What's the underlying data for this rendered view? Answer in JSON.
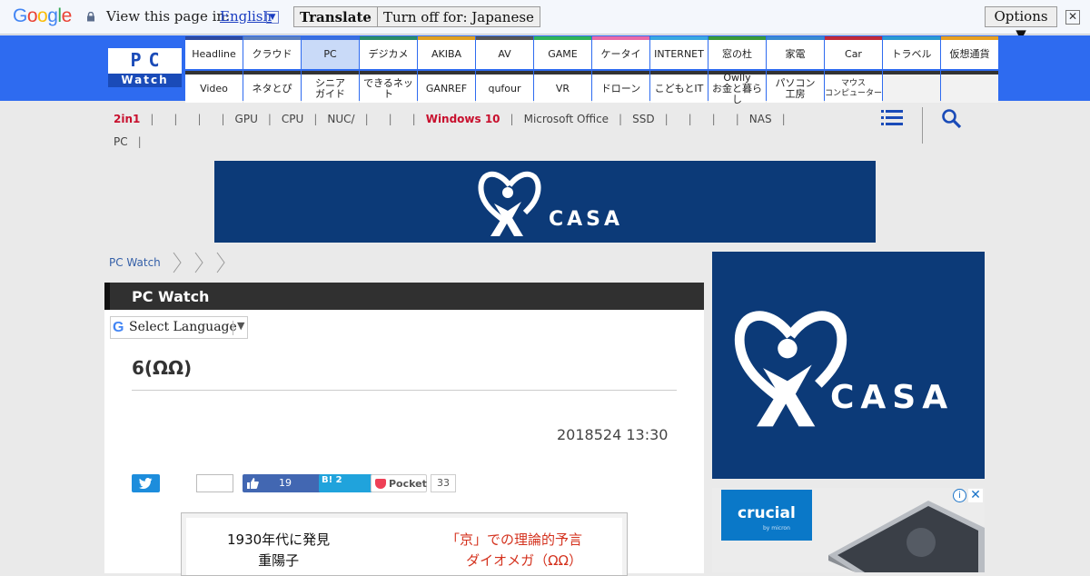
{
  "translate_bar": {
    "logo": "Google",
    "prompt": "View this page in:",
    "language": "English",
    "translate_button": "Translate",
    "turn_off_button": "Turn off for: Japanese",
    "options_button": "Options ▼",
    "close": "✕"
  },
  "site_logo": {
    "line1": "PC",
    "line2": "Watch"
  },
  "nav_row1": [
    {
      "label": "Headline",
      "color": "#2e4aa0"
    },
    {
      "label": "クラウド",
      "color": "#5b7fbf"
    },
    {
      "label": "PC",
      "color": "#3a6fe0",
      "active": true
    },
    {
      "label": "デジカメ",
      "color": "#2a8c6a"
    },
    {
      "label": "AKIBA",
      "color": "#e0a020"
    },
    {
      "label": "AV",
      "color": "#555555"
    },
    {
      "label": "GAME",
      "color": "#2fb35a"
    },
    {
      "label": "ケータイ",
      "color": "#e86aa8"
    },
    {
      "label": "INTERNET",
      "color": "#3aa8e0"
    },
    {
      "label": "窓の杜",
      "color": "#3a9a3a"
    },
    {
      "label": "家電",
      "color": "#3a8ad0"
    },
    {
      "label": "Car",
      "color": "#c02a3a"
    },
    {
      "label": "トラベル",
      "color": "#2a9ad0"
    },
    {
      "label": "仮想通貨",
      "color": "#e8a020"
    }
  ],
  "nav_row2": [
    {
      "label": "Video"
    },
    {
      "label": "ネタとぴ"
    },
    {
      "label": "シニア\nガイド"
    },
    {
      "label": "できるネット"
    },
    {
      "label": "GANREF"
    },
    {
      "label": "qufour"
    },
    {
      "label": "VR"
    },
    {
      "label": "ドローン"
    },
    {
      "label": "こどもとIT"
    },
    {
      "label": "Owlly\nお金と暮らし"
    },
    {
      "label": "パソコン\n工房"
    },
    {
      "label": "マウス\nコンピューター",
      "small": true
    },
    {
      "label": ""
    },
    {
      "label": ""
    }
  ],
  "subnav": {
    "items_line1": [
      {
        "label": "2in1",
        "hot": true
      },
      {
        "label": ""
      },
      {
        "label": ""
      },
      {
        "label": ""
      },
      {
        "label": "GPU"
      },
      {
        "label": "CPU"
      },
      {
        "label": "NUC/"
      },
      {
        "label": ""
      },
      {
        "label": ""
      },
      {
        "label": "Windows 10",
        "hot": true
      },
      {
        "label": "Microsoft Office"
      },
      {
        "label": "SSD"
      },
      {
        "label": ""
      },
      {
        "label": ""
      },
      {
        "label": ""
      },
      {
        "label": "NAS"
      }
    ],
    "items_line2": [
      {
        "label": "PC"
      }
    ]
  },
  "ads": {
    "banner_text": "CASA",
    "side_text": "CASA",
    "crucial_text": "crucial",
    "crucial_sub": "by micron"
  },
  "breadcrumb": {
    "home": "PC Watch"
  },
  "article": {
    "section": "PC Watch",
    "select_language": "Select Language",
    "title": "6(ΩΩ)",
    "date": "2018524 13:30",
    "fb_count": "19",
    "hatena_label": "B! 2",
    "pocket_label": "Pocket",
    "pocket_count": "33",
    "figure_left_1": "1930年代に発見",
    "figure_left_2": "重陽子",
    "figure_right_1": "「京」での理論的予言",
    "figure_right_2": "ダイオメガ（ΩΩ）"
  }
}
